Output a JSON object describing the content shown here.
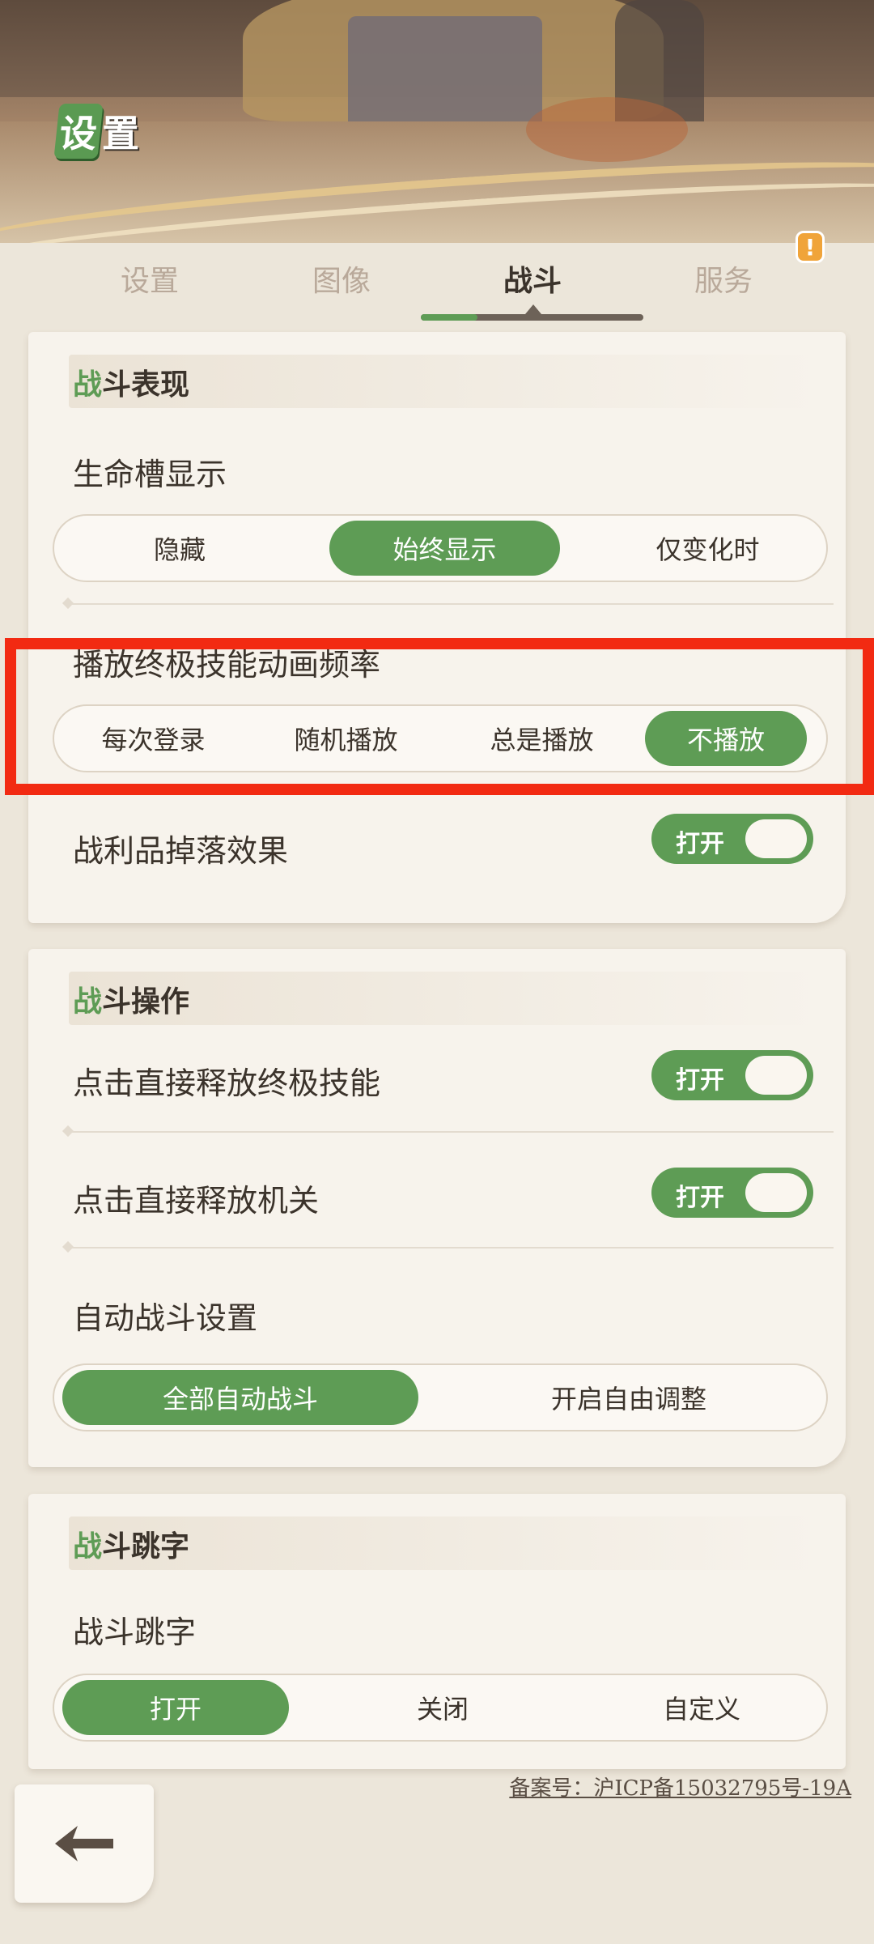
{
  "header": {
    "logo_badge": "设",
    "logo_text": "置"
  },
  "tabs": [
    {
      "label": "设置"
    },
    {
      "label": "图像"
    },
    {
      "label": "战斗"
    },
    {
      "label": "服务"
    }
  ],
  "active_tab": "战斗",
  "notice_badge": "!",
  "section1": {
    "title_hl": "战",
    "title_rest": "斗表现",
    "hp_bar_label": "生命槽显示",
    "hp_bar_options": [
      "隐藏",
      "始终显示",
      "仅变化时"
    ],
    "hp_bar_selected": "始终显示",
    "ult_anim_label": "播放终极技能动画频率",
    "ult_anim_options": [
      "每次登录",
      "随机播放",
      "总是播放",
      "不播放"
    ],
    "ult_anim_selected": "不播放",
    "loot_label": "战利品掉落效果",
    "loot_toggle": "打开"
  },
  "section2": {
    "title_hl": "战",
    "title_rest": "斗操作",
    "tap_ult_label": "点击直接释放终极技能",
    "tap_ult_toggle": "打开",
    "tap_trap_label": "点击直接释放机关",
    "tap_trap_toggle": "打开",
    "auto_label": "自动战斗设置",
    "auto_options": [
      "全部自动战斗",
      "开启自由调整"
    ],
    "auto_selected": "全部自动战斗"
  },
  "section3": {
    "title_hl": "战",
    "title_rest": "斗跳字",
    "dmg_label": "战斗跳字",
    "dmg_options": [
      "打开",
      "关闭",
      "自定义"
    ],
    "dmg_selected": "打开"
  },
  "footer": {
    "icp": "备案号：沪ICP备15032795号-19A",
    "back_icon": "back-arrow-icon"
  },
  "colors": {
    "accent": "#5e9c55",
    "highlight": "#f22a12",
    "bg": "#ece6da"
  }
}
